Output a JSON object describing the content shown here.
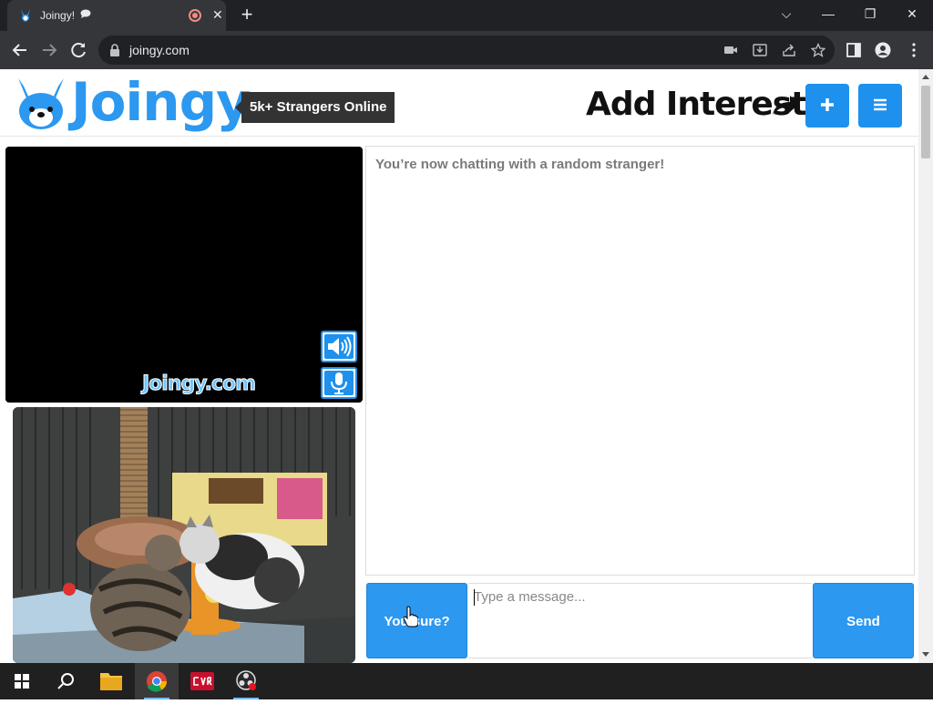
{
  "browser": {
    "tab_title": "Joingy!",
    "url": "joingy.com",
    "new_tab_label": "+",
    "close_tab_label": "✕"
  },
  "window_controls": {
    "tab_search": "⌵",
    "minimize": "—",
    "restore": "❐",
    "close": "✕"
  },
  "header": {
    "logo_text": "Joingy",
    "online_badge": "5k+ Strangers Online",
    "add_interests": "Add Interests"
  },
  "video": {
    "watermark": "Joingy.com"
  },
  "chat": {
    "status": "You’re now chatting with a random stranger!",
    "stop_button": "You sure?",
    "input_placeholder": "Type a message...",
    "send_button": "Send"
  },
  "colors": {
    "brand_blue": "#2c98f0",
    "browser_dark": "#202124",
    "browser_tab": "#35363a"
  },
  "taskbar": {
    "items": [
      "start-icon",
      "search-icon",
      "file-explorer-icon",
      "chrome-icon",
      "cvr-app-icon",
      "obs-icon"
    ]
  }
}
